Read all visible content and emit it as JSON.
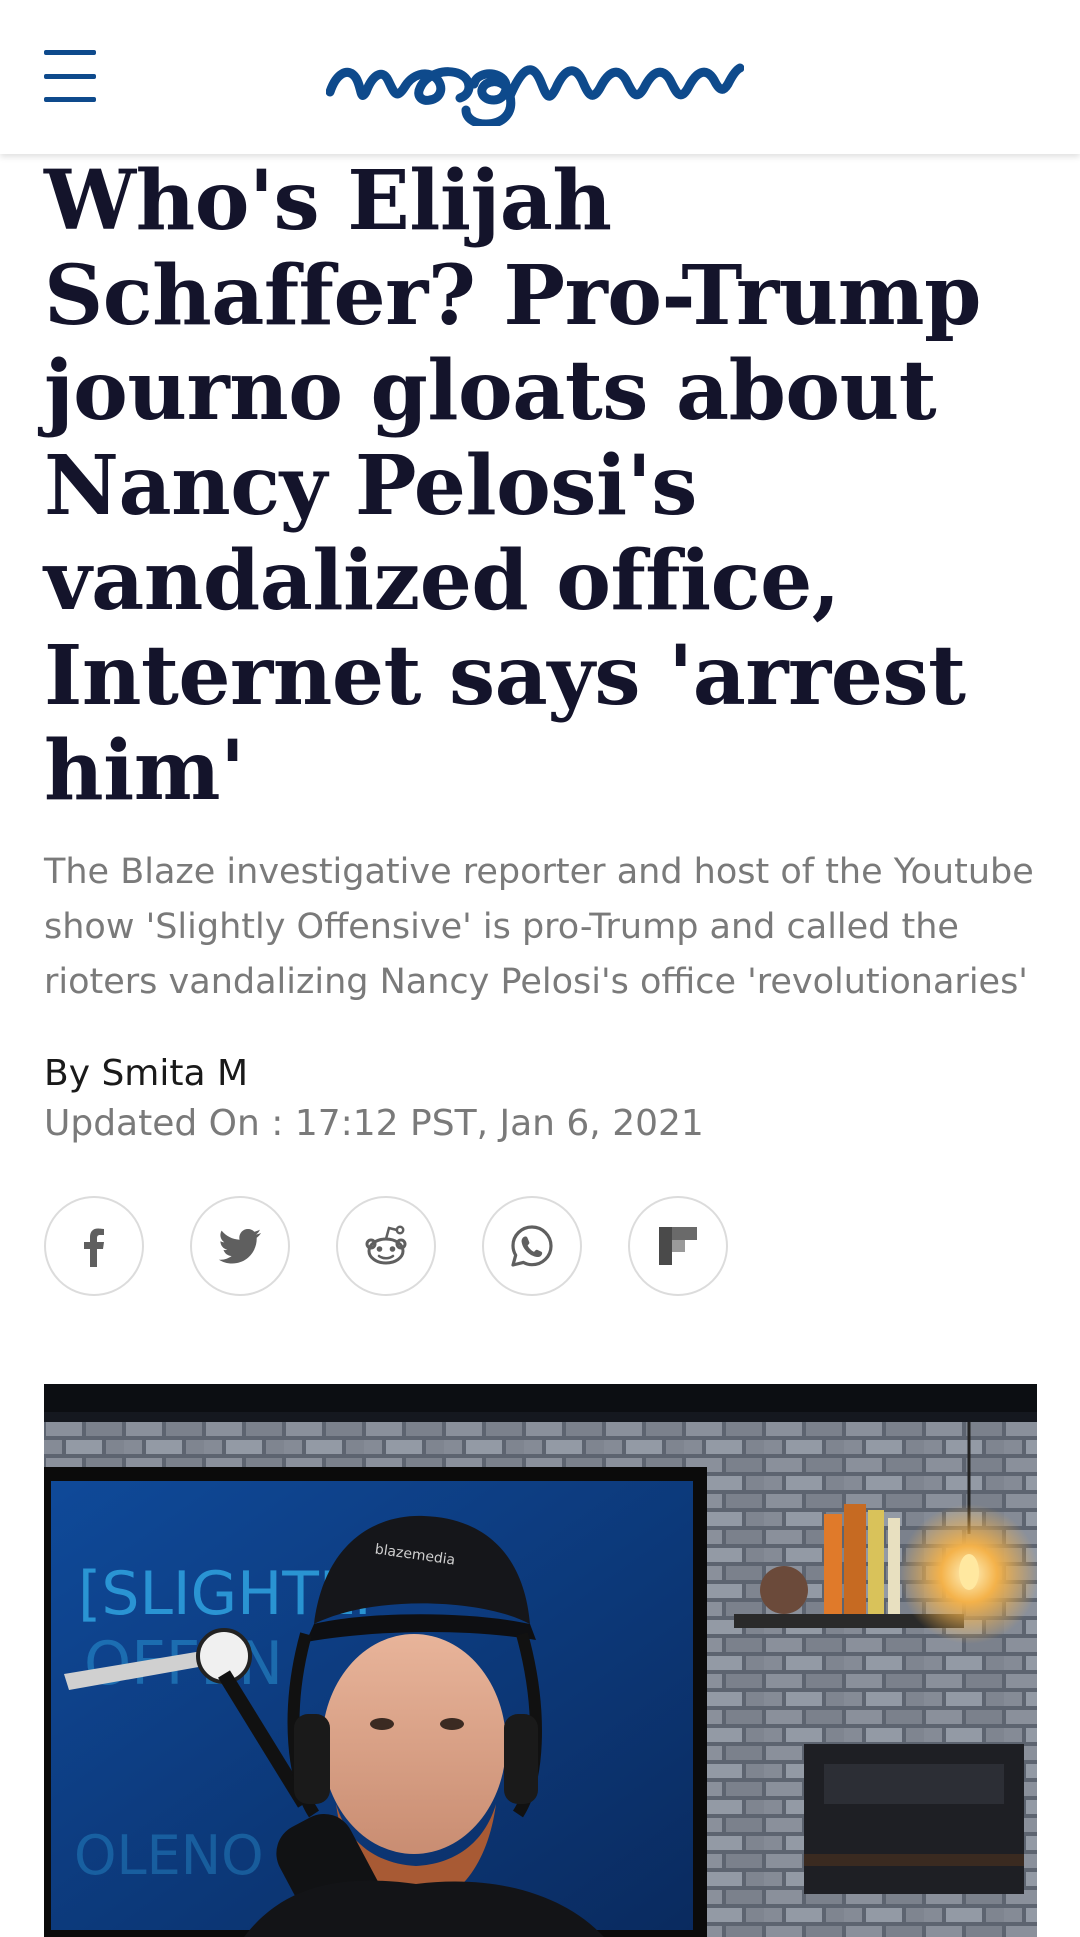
{
  "header": {
    "menu_icon": "hamburger-menu-icon",
    "logo_alt": "meaww",
    "colors": {
      "brand": "#0e4a8c"
    }
  },
  "article": {
    "headline": "Who's Elijah Schaffer? Pro-Trump journo gloats about Nancy Pelosi's vandalized office, Internet says 'arrest him'",
    "subheadline": "The Blaze investigative reporter and host of the Youtube show 'Slightly Offensive' is pro-Trump and called the rioters vandalizing Nancy Pelosi's office 'revolutionaries'",
    "byline": "By Smita M",
    "updated": "Updated On : 17:12 PST, Jan 6, 2021"
  },
  "share": {
    "buttons": [
      {
        "icon": "facebook-icon"
      },
      {
        "icon": "twitter-icon"
      },
      {
        "icon": "reddit-icon"
      },
      {
        "icon": "whatsapp-icon"
      },
      {
        "icon": "flipboard-icon"
      }
    ]
  },
  "hero_image": {
    "overlay_text": "[SLIGHTLY",
    "cap_text": "blazemedia"
  }
}
